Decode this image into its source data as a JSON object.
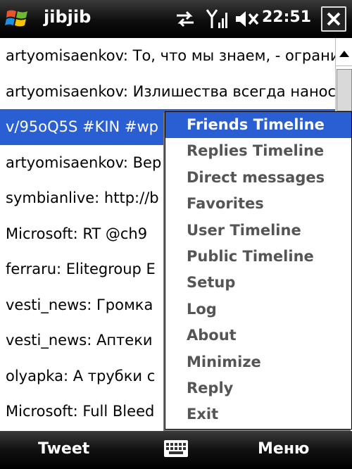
{
  "titlebar": {
    "app_title": "jibjib",
    "clock": "22:51",
    "icons": [
      "windows-start-icon",
      "connectivity-icon",
      "signal-icon",
      "volume-mute-icon",
      "close-icon"
    ]
  },
  "timeline": {
    "rows": [
      "artyomisaenkov: То, что мы знаем, - ограниченно",
      "artyomisaenkov: Излишества всегда нанося",
      "v/95oQ5S #KIN #wp",
      "artyomisaenkov: Вер",
      "symbianlive: http://b",
      "Microsoft: RT @ch9",
      "ferraru: Elitegroup E",
      "vesti_news: Громка",
      "vesti_news: Аптеки",
      "olyapka: А трубки с",
      "Microsoft: Full Bleed"
    ],
    "selected_index": 2
  },
  "menu": {
    "items": [
      "Friends Timeline",
      "Replies Timeline",
      "Direct messages",
      "Favorites",
      "User Timeline",
      "Public Timeline",
      "Setup",
      "Log",
      "About",
      "Minimize",
      "Reply",
      "Exit"
    ],
    "selected_index": 0
  },
  "softbar": {
    "left_label": "Tweet",
    "right_label": "Меню"
  },
  "colors": {
    "selection": "#2a5fd4",
    "menu_text": "#555555",
    "bar_background": "#000000"
  }
}
